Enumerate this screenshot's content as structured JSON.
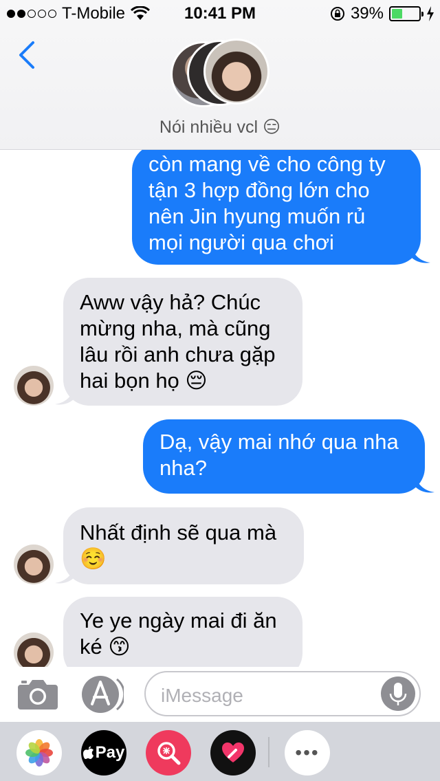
{
  "status_bar": {
    "carrier": "T-Mobile",
    "time": "10:41 PM",
    "battery": "39%",
    "battery_level": 0.39
  },
  "header": {
    "title": "Nói nhiều vcl 😑",
    "icons": [
      "back-chevron-icon",
      "group-avatars"
    ]
  },
  "messages": [
    {
      "direction": "out",
      "lines": [
        "còn mang về cho công ty",
        "tận 3 hợp đồng lớn cho",
        "nên Jin hyung muốn rủ",
        "mọi người qua chơi"
      ]
    },
    {
      "direction": "in",
      "lines": [
        "Aww vậy hả? Chúc",
        "mừng nha, mà cũng",
        "lâu rồi anh chưa gặp",
        "hai bọn họ 😔"
      ]
    },
    {
      "direction": "out",
      "lines": [
        "Dạ, vậy mai nhớ qua nha",
        "nha?"
      ]
    },
    {
      "direction": "in",
      "lines": [
        "Nhất định sẽ qua mà",
        "☺️"
      ]
    },
    {
      "direction": "in",
      "lines": [
        "Ye ye ngày mai đi ăn",
        "ké 😙"
      ]
    }
  ],
  "input_bar": {
    "placeholder": "iMessage",
    "icons": [
      "camera-icon",
      "app-store-icon",
      "microphone-icon"
    ]
  },
  "app_drawer": {
    "apps": [
      "photos-icon",
      "apple-pay-icon",
      "image-search-icon",
      "digital-touch-icon",
      "more-icon"
    ],
    "pay_label": "Pay",
    "more_label": "•••"
  },
  "colors": {
    "outgoing_bubble": "#1a7cfa",
    "incoming_bubble": "#e6e6eb",
    "accent": "#1a7cfa",
    "battery_fill": "#4cd964"
  }
}
